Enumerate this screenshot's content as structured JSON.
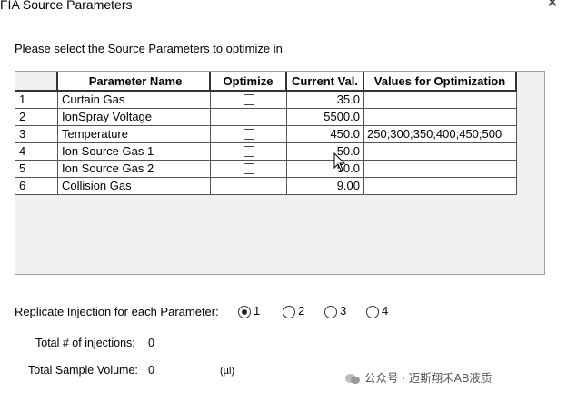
{
  "window": {
    "title": "FIA Source Parameters",
    "close_glyph": "✕"
  },
  "instruction": "Please select the Source Parameters to optimize in",
  "table": {
    "headers": [
      "",
      "Parameter Name",
      "Optimize",
      "Current Val.",
      "Values for Optimization"
    ],
    "rows": [
      {
        "index": "1",
        "name": "Curtain Gas",
        "optimize": false,
        "current": "35.0",
        "values": ""
      },
      {
        "index": "2",
        "name": "IonSpray Voltage",
        "optimize": false,
        "current": "5500.0",
        "values": ""
      },
      {
        "index": "3",
        "name": "Temperature",
        "optimize": false,
        "current": "450.0",
        "values": "250;300;350;400;450;500"
      },
      {
        "index": "4",
        "name": "Ion Source Gas 1",
        "optimize": false,
        "current": "50.0",
        "values": ""
      },
      {
        "index": "5",
        "name": "Ion Source Gas 2",
        "optimize": false,
        "current": "50.0",
        "values": ""
      },
      {
        "index": "6",
        "name": "Collision Gas",
        "optimize": false,
        "current": "9.00",
        "values": ""
      }
    ]
  },
  "replicate": {
    "label": "Replicate Injection for each Parameter:",
    "options": [
      "1",
      "2",
      "3",
      "4"
    ],
    "selected": "1"
  },
  "total_injections": {
    "label": "Total # of injections:",
    "value": "0"
  },
  "total_volume": {
    "label": "Total Sample Volume:",
    "value": "0",
    "unit": "(µl)"
  },
  "watermark": "公众号 · 迈斯翔禾AB液质",
  "icons": {
    "close": "close-icon",
    "cursor": "text-cursor-icon",
    "watermark": "wechat-icon"
  }
}
